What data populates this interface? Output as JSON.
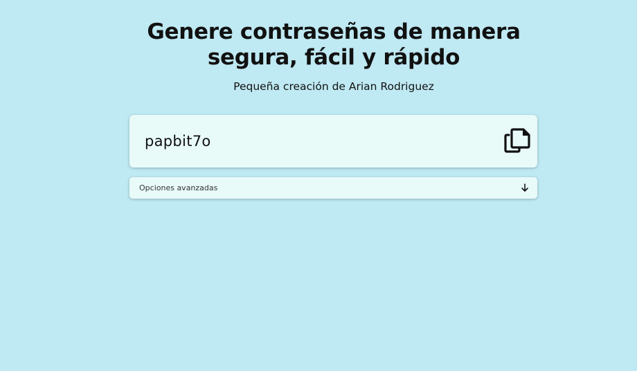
{
  "header": {
    "title_line1": "Genere contraseñas de manera",
    "title_line2": "segura, fácil y rápido",
    "subtitle": "Pequeña creación de Arian Rodriguez"
  },
  "password": {
    "value": "papbit7o",
    "copy_icon": "copy-icon"
  },
  "options": {
    "label": "Opciones avanzadas",
    "toggle_icon": "arrow-down-icon"
  },
  "colors": {
    "background": "#bfe9f3",
    "card": "#e8fbf9",
    "text": "#111111"
  }
}
